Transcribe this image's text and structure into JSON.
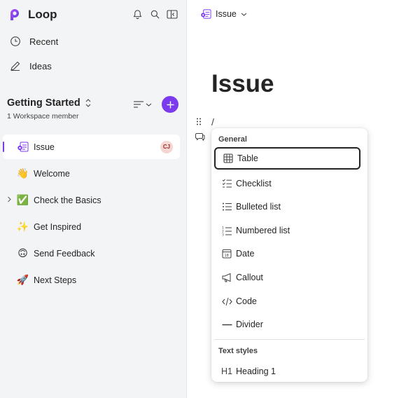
{
  "app": {
    "name": "Loop",
    "accent": "#7c3aed"
  },
  "top_icons": [
    "bell-icon",
    "search-icon",
    "sidebar-toggle-icon"
  ],
  "nav": [
    {
      "label": "Recent",
      "icon": "clock-icon"
    },
    {
      "label": "Ideas",
      "icon": "pen-icon"
    }
  ],
  "workspace": {
    "title": "Getting Started",
    "members": "1 Workspace member"
  },
  "pages": [
    {
      "label": "Issue",
      "emoji": "",
      "active": true,
      "avatar": "CJ"
    },
    {
      "label": "Welcome",
      "emoji": "👋"
    },
    {
      "label": "Check the Basics",
      "emoji": "✅",
      "expandable": true
    },
    {
      "label": "Get Inspired",
      "emoji": "✨"
    },
    {
      "label": "Send Feedback",
      "emoji": "🙃"
    },
    {
      "label": "Next Steps",
      "emoji": "🚀"
    }
  ],
  "main": {
    "breadcrumb": "Issue",
    "heading": "Issue",
    "slash": "/"
  },
  "menu": {
    "section_general": "General",
    "section_text_styles": "Text styles",
    "items": [
      {
        "label": "Table",
        "icon": "table-icon"
      },
      {
        "label": "Checklist",
        "icon": "checklist-icon"
      },
      {
        "label": "Bulleted list",
        "icon": "bulleted-list-icon"
      },
      {
        "label": "Numbered list",
        "icon": "numbered-list-icon"
      },
      {
        "label": "Date",
        "icon": "calendar-icon"
      },
      {
        "label": "Callout",
        "icon": "megaphone-icon"
      },
      {
        "label": "Code",
        "icon": "code-icon"
      },
      {
        "label": "Divider",
        "icon": "divider-icon"
      }
    ],
    "text_items": [
      {
        "label": "Heading 1",
        "icon_text": "H1"
      }
    ]
  }
}
